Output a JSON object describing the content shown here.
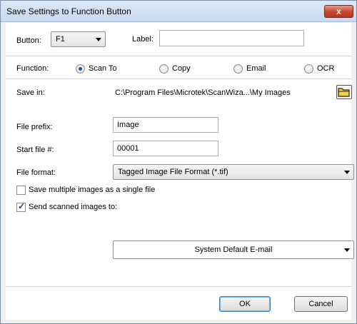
{
  "window": {
    "title": "Save Settings to Function Button",
    "close_glyph": "x"
  },
  "button": {
    "label": "Button:",
    "value": "F1"
  },
  "label_field": {
    "label": "Label:",
    "value": ""
  },
  "function": {
    "label": "Function:",
    "options": [
      {
        "label": "Scan To",
        "selected": true
      },
      {
        "label": "Copy",
        "selected": false
      },
      {
        "label": "Email",
        "selected": false
      },
      {
        "label": "OCR",
        "selected": false
      }
    ]
  },
  "save_in": {
    "label": "Save in:",
    "path": "C:\\Program Files\\Microtek\\ScanWiza...\\My Images",
    "icon": "folder-icon"
  },
  "file_prefix": {
    "label": "File prefix:",
    "value": "Image"
  },
  "start_file": {
    "label": "Start file #:",
    "value": "00001"
  },
  "file_format": {
    "label": "File format:",
    "value": "Tagged Image File Format (*.tif)"
  },
  "save_multiple": {
    "label": "Save multiple images as a single file",
    "checked": false
  },
  "send_scanned": {
    "label": "Send scanned images to:",
    "checked": true,
    "target": "System Default E-mail"
  },
  "actions": {
    "ok": "OK",
    "cancel": "Cancel"
  },
  "colors": {
    "title_bar": "#c8daf0",
    "close_button": "#c7442e",
    "accent": "#1b4f9c"
  }
}
